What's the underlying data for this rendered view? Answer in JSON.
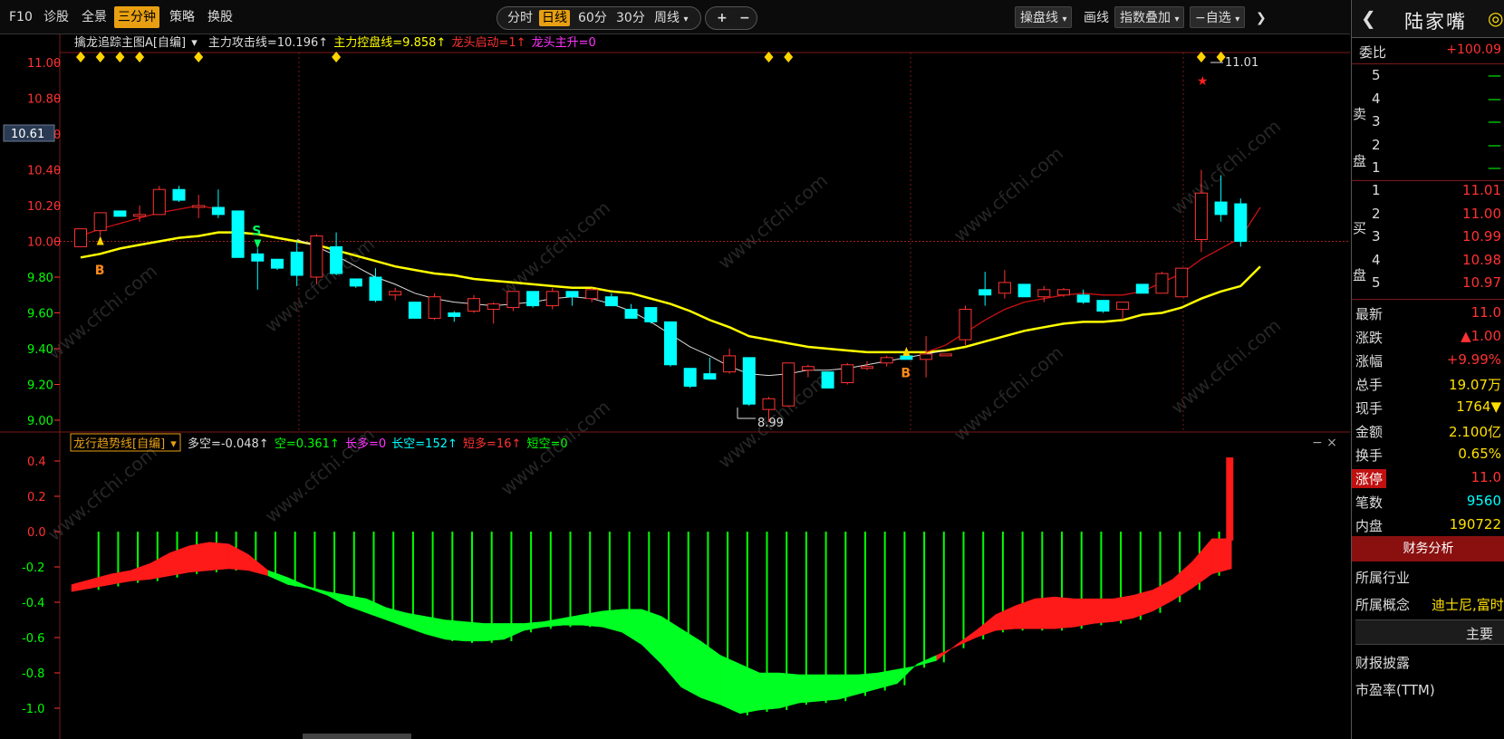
{
  "toolbar": {
    "f10": "F10",
    "diagnose": "诊股",
    "panorama": "全景",
    "three_min": "三分钟",
    "strategy": "策略",
    "swap": "换股"
  },
  "period": {
    "fenshi": "分时",
    "daily": "日线",
    "m60": "60分",
    "m30": "30分",
    "weekly": "周线",
    "plus": "+",
    "minus": "−"
  },
  "right_tools": {
    "operate": "操盘线",
    "draw": "画线",
    "index_overlay": "指数叠加",
    "self_select": "−自选",
    "more": "❯"
  },
  "main_indicator": {
    "name": "擒龙追踪主图A[自编]",
    "attack": "主力攻击线=10.196↑",
    "control": "主力控盘线=9.858↑",
    "start": "龙头启动=1↑",
    "rise": "龙头主升=0"
  },
  "sub_indicator": {
    "name": "龙行趋势线[自编]",
    "duokong": "多空=-0.048↑",
    "kong": "空=0.361↑",
    "changduo": "长多=0",
    "changkong": "长空=152↑",
    "duanduo": "短多=16↑",
    "duankong": "短空=0",
    "close": "− ×"
  },
  "price_axis": [
    "11.00",
    "10.80",
    "10.60",
    "10.40",
    "10.20",
    "10.00",
    "9.80",
    "9.60",
    "9.40",
    "9.20",
    "9.00"
  ],
  "current_price_label": "10.61",
  "sub_axis": [
    "0.4",
    "0.2",
    "0.0",
    "-0.2",
    "-0.4",
    "-0.6",
    "-0.8",
    "-1.0"
  ],
  "annotations": {
    "high": "11.01",
    "low": "8.99",
    "buy": "B",
    "sell": "S"
  },
  "watermark": "www.cfchi.com",
  "colors": {
    "up": "#ff3232",
    "down": "#00ffff",
    "ma_yellow": "#ffff00",
    "ma_white": "#dddddd",
    "ma_red": "#cc1111",
    "green_bar": "#00ff00",
    "accent": "#e8a012"
  },
  "candles": [
    {
      "o": 9.97,
      "h": 10.07,
      "l": 9.97,
      "c": 10.07
    },
    {
      "o": 10.06,
      "h": 10.16,
      "l": 10.03,
      "c": 10.16
    },
    {
      "o": 10.17,
      "h": 10.17,
      "l": 10.14,
      "c": 10.14
    },
    {
      "o": 10.14,
      "h": 10.2,
      "l": 10.11,
      "c": 10.15
    },
    {
      "o": 10.15,
      "h": 10.31,
      "l": 10.15,
      "c": 10.29
    },
    {
      "o": 10.29,
      "h": 10.31,
      "l": 10.22,
      "c": 10.23
    },
    {
      "o": 10.19,
      "h": 10.26,
      "l": 10.13,
      "c": 10.2
    },
    {
      "o": 10.19,
      "h": 10.29,
      "l": 10.13,
      "c": 10.15
    },
    {
      "o": 10.17,
      "h": 10.17,
      "l": 9.91,
      "c": 9.91
    },
    {
      "o": 9.93,
      "h": 9.96,
      "l": 9.73,
      "c": 9.89
    },
    {
      "o": 9.9,
      "h": 9.9,
      "l": 9.84,
      "c": 9.85
    },
    {
      "o": 9.94,
      "h": 10.0,
      "l": 9.75,
      "c": 9.81
    },
    {
      "o": 9.8,
      "h": 10.04,
      "l": 9.76,
      "c": 10.03
    },
    {
      "o": 9.97,
      "h": 10.05,
      "l": 9.81,
      "c": 9.82
    },
    {
      "o": 9.79,
      "h": 9.79,
      "l": 9.74,
      "c": 9.75
    },
    {
      "o": 9.8,
      "h": 9.85,
      "l": 9.66,
      "c": 9.67
    },
    {
      "o": 9.7,
      "h": 9.74,
      "l": 9.67,
      "c": 9.72
    },
    {
      "o": 9.66,
      "h": 9.66,
      "l": 9.57,
      "c": 9.57
    },
    {
      "o": 9.57,
      "h": 9.71,
      "l": 9.56,
      "c": 9.69
    },
    {
      "o": 9.6,
      "h": 9.61,
      "l": 9.55,
      "c": 9.58
    },
    {
      "o": 9.61,
      "h": 9.7,
      "l": 9.6,
      "c": 9.68
    },
    {
      "o": 9.62,
      "h": 9.66,
      "l": 9.54,
      "c": 9.65
    },
    {
      "o": 9.63,
      "h": 9.72,
      "l": 9.61,
      "c": 9.72
    },
    {
      "o": 9.72,
      "h": 9.72,
      "l": 9.63,
      "c": 9.64
    },
    {
      "o": 9.64,
      "h": 9.74,
      "l": 9.62,
      "c": 9.72
    },
    {
      "o": 9.72,
      "h": 9.72,
      "l": 9.64,
      "c": 9.69
    },
    {
      "o": 9.68,
      "h": 9.74,
      "l": 9.66,
      "c": 9.73
    },
    {
      "o": 9.69,
      "h": 9.71,
      "l": 9.64,
      "c": 9.64
    },
    {
      "o": 9.62,
      "h": 9.65,
      "l": 9.57,
      "c": 9.57
    },
    {
      "o": 9.63,
      "h": 9.63,
      "l": 9.54,
      "c": 9.55
    },
    {
      "o": 9.55,
      "h": 9.55,
      "l": 9.3,
      "c": 9.31
    },
    {
      "o": 9.29,
      "h": 9.29,
      "l": 9.18,
      "c": 9.19
    },
    {
      "o": 9.26,
      "h": 9.35,
      "l": 9.24,
      "c": 9.23
    },
    {
      "o": 9.27,
      "h": 9.4,
      "l": 9.26,
      "c": 9.36
    },
    {
      "o": 9.35,
      "h": 9.35,
      "l": 9.08,
      "c": 9.09
    },
    {
      "o": 9.06,
      "h": 9.13,
      "l": 8.99,
      "c": 9.12
    },
    {
      "o": 9.08,
      "h": 9.32,
      "l": 9.08,
      "c": 9.32
    },
    {
      "o": 9.28,
      "h": 9.31,
      "l": 9.24,
      "c": 9.3
    },
    {
      "o": 9.27,
      "h": 9.27,
      "l": 9.18,
      "c": 9.18
    },
    {
      "o": 9.21,
      "h": 9.32,
      "l": 9.2,
      "c": 9.31
    },
    {
      "o": 9.29,
      "h": 9.33,
      "l": 9.28,
      "c": 9.3
    },
    {
      "o": 9.32,
      "h": 9.36,
      "l": 9.3,
      "c": 9.35
    },
    {
      "o": 9.36,
      "h": 9.4,
      "l": 9.34,
      "c": 9.34
    },
    {
      "o": 9.34,
      "h": 9.47,
      "l": 9.24,
      "c": 9.37
    },
    {
      "o": 9.36,
      "h": 9.37,
      "l": 9.36,
      "c": 9.37
    },
    {
      "o": 9.45,
      "h": 9.64,
      "l": 9.42,
      "c": 9.62
    },
    {
      "o": 9.73,
      "h": 9.83,
      "l": 9.64,
      "c": 9.7
    },
    {
      "o": 9.71,
      "h": 9.84,
      "l": 9.68,
      "c": 9.77
    },
    {
      "o": 9.76,
      "h": 9.76,
      "l": 9.69,
      "c": 9.69
    },
    {
      "o": 9.69,
      "h": 9.75,
      "l": 9.66,
      "c": 9.73
    },
    {
      "o": 9.7,
      "h": 9.74,
      "l": 9.69,
      "c": 9.73
    },
    {
      "o": 9.7,
      "h": 9.73,
      "l": 9.65,
      "c": 9.66
    },
    {
      "o": 9.67,
      "h": 9.67,
      "l": 9.6,
      "c": 9.61
    },
    {
      "o": 9.62,
      "h": 9.66,
      "l": 9.56,
      "c": 9.66
    },
    {
      "o": 9.76,
      "h": 9.76,
      "l": 9.71,
      "c": 9.71
    },
    {
      "o": 9.71,
      "h": 9.83,
      "l": 9.71,
      "c": 9.82
    },
    {
      "o": 9.69,
      "h": 9.85,
      "l": 9.69,
      "c": 9.85
    },
    {
      "o": 10.01,
      "h": 10.4,
      "l": 9.94,
      "c": 10.27
    },
    {
      "o": 10.22,
      "h": 10.37,
      "l": 10.11,
      "c": 10.15
    },
    {
      "o": 10.21,
      "h": 10.24,
      "l": 9.97,
      "c": 10.0
    }
  ],
  "ma_yellow": [
    9.91,
    9.93,
    9.96,
    9.98,
    10.0,
    10.02,
    10.03,
    10.05,
    10.05,
    10.04,
    10.02,
    10.0,
    9.98,
    9.95,
    9.92,
    9.89,
    9.86,
    9.84,
    9.82,
    9.81,
    9.79,
    9.78,
    9.77,
    9.76,
    9.75,
    9.74,
    9.74,
    9.72,
    9.71,
    9.68,
    9.65,
    9.61,
    9.56,
    9.52,
    9.47,
    9.45,
    9.43,
    9.41,
    9.4,
    9.39,
    9.38,
    9.38,
    9.38,
    9.38,
    9.39,
    9.41,
    9.44,
    9.47,
    9.5,
    9.52,
    9.54,
    9.55,
    9.55,
    9.56,
    9.59,
    9.6,
    9.63,
    9.68,
    9.72,
    9.75,
    9.86
  ],
  "ma_white": [
    null,
    null,
    null,
    null,
    null,
    null,
    null,
    null,
    null,
    null,
    null,
    10.01,
    9.97,
    9.92,
    9.86,
    9.8,
    9.76,
    9.71,
    9.68,
    9.66,
    9.65,
    9.64,
    9.65,
    9.66,
    9.68,
    9.69,
    9.68,
    9.65,
    9.61,
    9.55,
    9.48,
    9.41,
    9.36,
    9.3,
    9.26,
    9.25,
    9.26,
    9.28,
    9.28,
    9.29,
    9.31,
    9.33,
    9.35,
    9.37,
    9.39,
    null,
    null,
    null,
    null,
    null,
    null,
    null,
    null,
    null,
    null,
    null,
    null,
    null,
    null,
    null,
    null
  ],
  "ma_red": [
    10.03,
    10.07,
    10.1,
    10.13,
    10.16,
    10.18,
    10.2,
    10.18,
    null,
    null,
    null,
    null,
    null,
    null,
    null,
    null,
    null,
    null,
    null,
    null,
    null,
    null,
    null,
    null,
    null,
    null,
    null,
    null,
    null,
    null,
    null,
    null,
    null,
    null,
    null,
    null,
    null,
    null,
    null,
    null,
    null,
    null,
    null,
    9.38,
    9.42,
    9.49,
    9.56,
    9.62,
    9.66,
    9.68,
    9.7,
    9.71,
    9.7,
    9.7,
    9.72,
    9.77,
    9.82,
    9.9,
    9.96,
    10.02,
    10.19
  ],
  "diamonds": [
    0,
    1,
    2,
    3,
    6,
    13,
    35,
    36,
    57,
    58
  ],
  "sub_upper": [
    -0.3,
    -0.27,
    -0.24,
    -0.22,
    -0.18,
    -0.12,
    -0.08,
    -0.06,
    -0.07,
    -0.13,
    -0.22,
    -0.26,
    -0.31,
    -0.34,
    -0.36,
    -0.38,
    -0.43,
    -0.46,
    -0.48,
    -0.5,
    -0.51,
    -0.52,
    -0.52,
    -0.52,
    -0.51,
    -0.49,
    -0.47,
    -0.45,
    -0.44,
    -0.44,
    -0.48,
    -0.55,
    -0.62,
    -0.7,
    -0.75,
    -0.8,
    -0.8,
    -0.81,
    -0.81,
    -0.81,
    -0.81,
    -0.8,
    -0.78,
    -0.76,
    -0.73,
    -0.64,
    -0.56,
    -0.47,
    -0.42,
    -0.38,
    -0.37,
    -0.38,
    -0.38,
    -0.38,
    -0.36,
    -0.33,
    -0.27,
    -0.17,
    -0.04,
    -0.04,
    0.4
  ],
  "sub_lower": [
    -0.34,
    -0.32,
    -0.3,
    -0.28,
    -0.27,
    -0.25,
    -0.23,
    -0.22,
    -0.21,
    -0.22,
    -0.25,
    -0.3,
    -0.32,
    -0.36,
    -0.42,
    -0.46,
    -0.5,
    -0.54,
    -0.58,
    -0.61,
    -0.62,
    -0.62,
    -0.61,
    -0.56,
    -0.54,
    -0.53,
    -0.53,
    -0.54,
    -0.57,
    -0.64,
    -0.75,
    -0.88,
    -0.94,
    -0.98,
    -1.03,
    -1.01,
    -1.0,
    -0.97,
    -0.96,
    -0.95,
    -0.92,
    -0.89,
    -0.86,
    -0.75,
    -0.7,
    -0.65,
    -0.6,
    -0.56,
    -0.55,
    -0.55,
    -0.55,
    -0.54,
    -0.52,
    -0.51,
    -0.49,
    -0.45,
    -0.39,
    -0.32,
    -0.24,
    -0.21,
    -0.04
  ],
  "green_bars_range": [
    1,
    58
  ],
  "quote": {
    "stock_name": "陆家嘴",
    "back": "❮",
    "weibi_label": "委比",
    "weibi_value": "+100.09",
    "sell_label": "卖盘",
    "buy_label": "买盘",
    "asks": [
      {
        "lvl": "5",
        "price": "—"
      },
      {
        "lvl": "4",
        "price": "—"
      },
      {
        "lvl": "3",
        "price": "—"
      },
      {
        "lvl": "2",
        "price": "—"
      },
      {
        "lvl": "1",
        "price": "—"
      }
    ],
    "bids": [
      {
        "lvl": "1",
        "price": "11.01"
      },
      {
        "lvl": "2",
        "price": "11.00"
      },
      {
        "lvl": "3",
        "price": "10.99"
      },
      {
        "lvl": "4",
        "price": "10.98"
      },
      {
        "lvl": "5",
        "price": "10.97"
      }
    ],
    "stats": [
      {
        "k": "最新",
        "v": "11.0",
        "c": "#ff3232"
      },
      {
        "k": "涨跌",
        "v": "▲1.00",
        "c": "#ff3232"
      },
      {
        "k": "涨幅",
        "v": "+9.99%",
        "c": "#ff3232"
      },
      {
        "k": "总手",
        "v": "19.07万",
        "c": "#ffe000"
      },
      {
        "k": "现手",
        "v": "1764▼",
        "c": "#ffe000"
      },
      {
        "k": "金额",
        "v": "2.100亿",
        "c": "#ffe000"
      },
      {
        "k": "换手",
        "v": "0.65%",
        "c": "#ffe000"
      },
      {
        "k": "涨停",
        "v": "11.0",
        "c": "#ff3232"
      },
      {
        "k": "笔数",
        "v": "9560",
        "c": "#00ffff"
      },
      {
        "k": "内盘",
        "v": "190722",
        "c": "#ffe000"
      }
    ],
    "fin_analysis": "财务分析",
    "industry_label": "所属行业",
    "concept_label": "所属概念",
    "concept_value": "迪士尼,富时",
    "main": "主要",
    "report": "财报披露",
    "pe": "市盈率(TTM)"
  }
}
